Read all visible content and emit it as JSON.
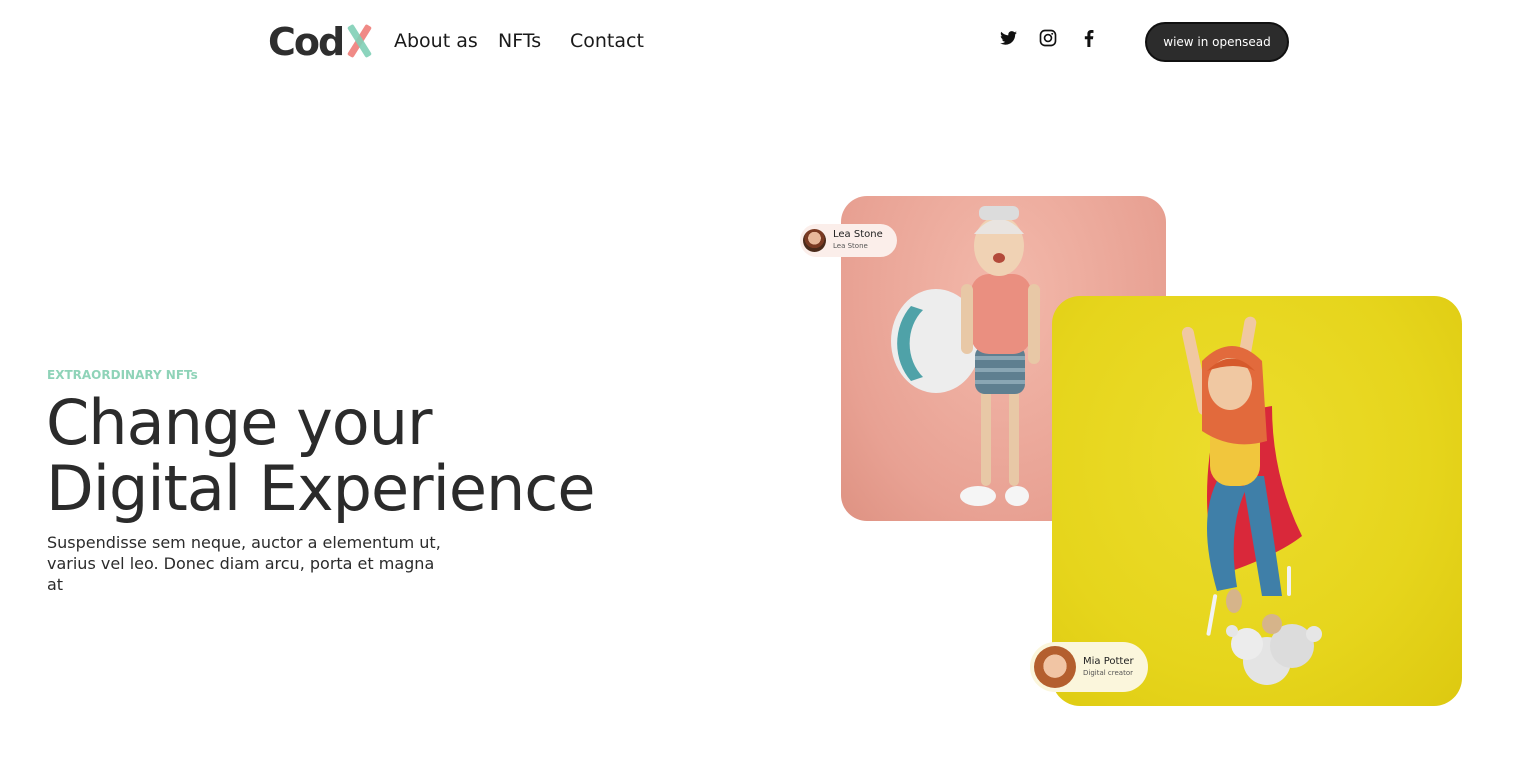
{
  "header": {
    "logo_text": "Cod",
    "logo_mark": "X",
    "nav": [
      {
        "label": "About as"
      },
      {
        "label": "NFTs"
      },
      {
        "label": "Contact"
      }
    ],
    "social": [
      {
        "icon": "twitter-icon"
      },
      {
        "icon": "instagram-icon"
      },
      {
        "icon": "facebook-icon"
      }
    ],
    "cta_label": "wiew in opensead"
  },
  "hero": {
    "eyebrow": "EXTRAORDINARY NFTs",
    "headline_line1": "Change your",
    "headline_line2": "Digital Experience",
    "subtitle_line1": "Suspendisse sem neque, auctor a elementum ut,",
    "subtitle_line2": "varius vel leo. Donec diam arcu, porta et magna at"
  },
  "cards": [
    {
      "name": "Lea Stone",
      "role": "Lea Stone",
      "bg_color": "#e8a193"
    },
    {
      "name": "Mia Potter",
      "role": "Digital creator",
      "bg_color": "#e6d51c"
    }
  ],
  "colors": {
    "accent_green": "#8fd3b8",
    "logo_pink": "#f08a86",
    "button_dark": "#2c2c2c",
    "text_dark": "#2b2b2b"
  }
}
